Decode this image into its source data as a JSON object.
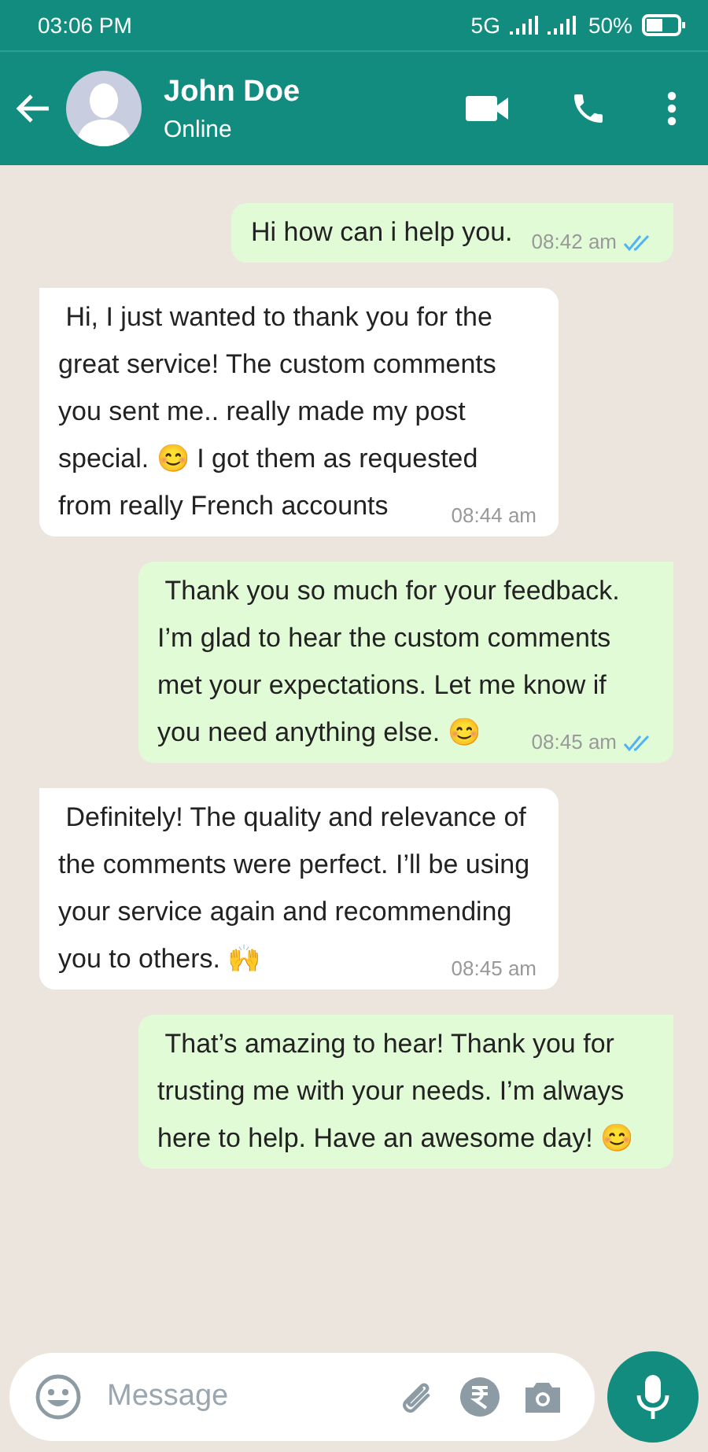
{
  "status_bar": {
    "time": "03:06 PM",
    "network": "5G",
    "battery": "50%"
  },
  "header": {
    "name": "John Doe",
    "status": "Online"
  },
  "messages": [
    {
      "outgoing": true,
      "text": "Hi how can i help you.",
      "time": "08:42 am",
      "read": true
    },
    {
      "outgoing": false,
      "text": " Hi, I just wanted to thank you for the great service! The custom comments you sent me.. really made my post special. 😊 I got them as requested from really French accounts",
      "time": "08:44 am"
    },
    {
      "outgoing": true,
      "text": " Thank you so much for your feedback. I’m glad to hear the custom comments met your expectations. Let me know if you need anything else. 😊",
      "time": "08:45 am",
      "read": true
    },
    {
      "outgoing": false,
      "text": " Definitely! The quality and relevance of the comments were perfect. I’ll be using your service again and recommending you to others. 🙌",
      "time": "08:45 am"
    },
    {
      "outgoing": true,
      "text": " That’s amazing to hear! Thank you for trusting me with your needs. I’m always here to help. Have an awesome day! 😊"
    }
  ],
  "composer": {
    "placeholder": "Message"
  }
}
